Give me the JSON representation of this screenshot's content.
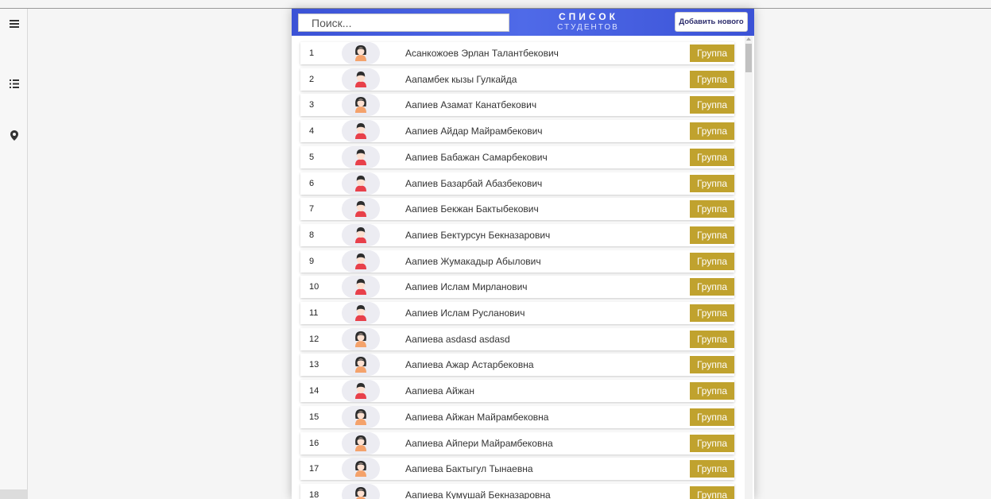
{
  "sidebar": {
    "icons": [
      "menu-icon",
      "numbered-list-icon",
      "map-pin-icon"
    ]
  },
  "header": {
    "search_placeholder": "Поиск...",
    "title_main": "СПИСОК",
    "title_sub": "СТУДЕНТОВ",
    "add_button_label": "Добавить нового"
  },
  "group_button_label": "Группа",
  "colors": {
    "header_blue": "#3b52d6",
    "group_button": "#c0a22e",
    "female_avatar": "#f4a26b",
    "male_avatar": "#e8404a"
  },
  "students": [
    {
      "num": "1",
      "name": "Асанкожоев Эрлан Талантбекович",
      "avatar": "female"
    },
    {
      "num": "2",
      "name": "Аапамбек кызы Гулкайда",
      "avatar": "male"
    },
    {
      "num": "3",
      "name": "Аапиев Азамат Канатбекович",
      "avatar": "female"
    },
    {
      "num": "4",
      "name": "Аапиев Айдар Майрамбекович",
      "avatar": "male"
    },
    {
      "num": "5",
      "name": "Аапиев Бабажан Самарбекович",
      "avatar": "male"
    },
    {
      "num": "6",
      "name": "Аапиев Базарбай Абазбекович",
      "avatar": "male"
    },
    {
      "num": "7",
      "name": "Аапиев Бекжан Бактыбекович",
      "avatar": "male"
    },
    {
      "num": "8",
      "name": "Аапиев Бектурсун Бекназарович",
      "avatar": "male"
    },
    {
      "num": "9",
      "name": "Аапиев Жумакадыр Абылович",
      "avatar": "male"
    },
    {
      "num": "10",
      "name": "Аапиев Ислам Мирланович",
      "avatar": "male"
    },
    {
      "num": "11",
      "name": "Аапиев Ислам Русланович",
      "avatar": "male"
    },
    {
      "num": "12",
      "name": "Аапиева asdasd asdasd",
      "avatar": "female"
    },
    {
      "num": "13",
      "name": "Аапиева Ажар Астарбековна",
      "avatar": "female"
    },
    {
      "num": "14",
      "name": "Аапиева Айжан",
      "avatar": "male"
    },
    {
      "num": "15",
      "name": "Аапиева Айжан Майрамбековна",
      "avatar": "female"
    },
    {
      "num": "16",
      "name": "Аапиева Айпери Майрамбековна",
      "avatar": "female"
    },
    {
      "num": "17",
      "name": "Аапиева Бактыгул Тынаевна",
      "avatar": "female"
    },
    {
      "num": "18",
      "name": "Аапиева Кумушай Бекназаровна",
      "avatar": "female"
    }
  ]
}
